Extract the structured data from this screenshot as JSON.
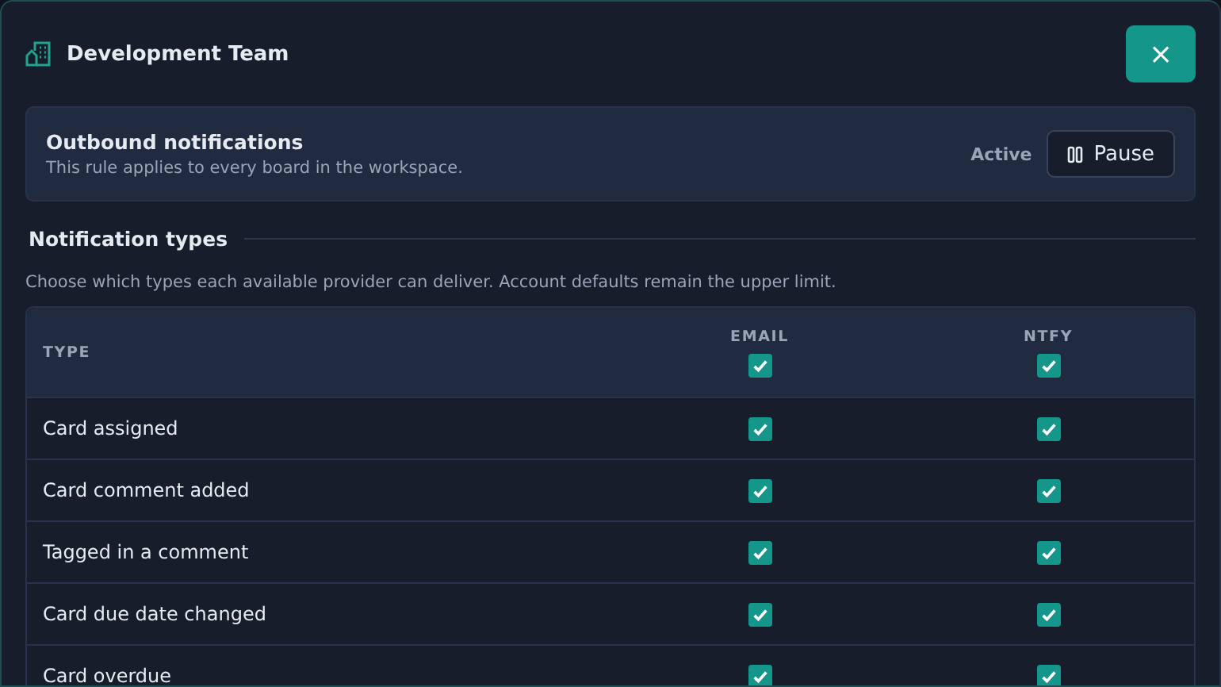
{
  "dialog": {
    "title": "Development Team",
    "close": "×"
  },
  "rule": {
    "title": "Outbound notifications",
    "description": "This rule applies to every board in the workspace.",
    "status": "Active",
    "pause_button": "Pause"
  },
  "section": {
    "title": "Notification types",
    "hint": "Choose which types each available provider can deliver. Account defaults remain the upper limit."
  },
  "table": {
    "type_column": "TYPE",
    "providers": [
      {
        "label": "EMAIL",
        "checked": true
      },
      {
        "label": "NTFY",
        "checked": true
      }
    ],
    "rows": [
      {
        "label": "Card assigned",
        "checks": [
          true,
          true
        ]
      },
      {
        "label": "Card comment added",
        "checks": [
          true,
          true
        ]
      },
      {
        "label": "Tagged in a comment",
        "checks": [
          true,
          true
        ]
      },
      {
        "label": "Card due date changed",
        "checks": [
          true,
          true
        ]
      },
      {
        "label": "Card overdue",
        "checks": [
          true,
          true
        ]
      }
    ]
  }
}
